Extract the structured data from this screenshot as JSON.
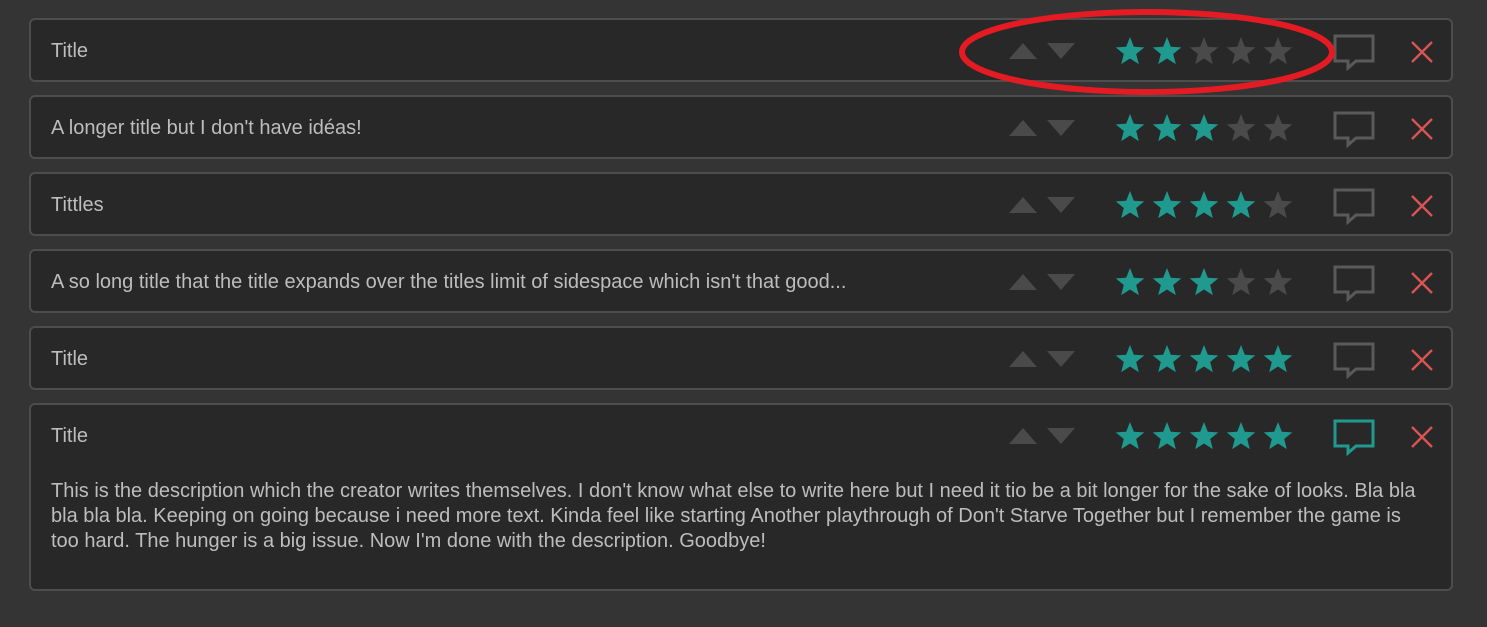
{
  "colors": {
    "background": "#343434",
    "card": "#282828",
    "card_border": "#4d4d4d",
    "text": "#bdbdbd",
    "star_filled": "#20998f",
    "star_empty": "#4a4a4a",
    "arrow": "#4a4a4a",
    "comment_default": "#5a5a5a",
    "comment_active": "#20998f",
    "close": "#d95454",
    "annotation": "#e41b23"
  },
  "items": [
    {
      "title": "Title",
      "rating": 2,
      "max_rating": 5,
      "comment_active": false,
      "expanded": false
    },
    {
      "title": "A longer title but I don't have idéas!",
      "rating": 3,
      "max_rating": 5,
      "comment_active": false,
      "expanded": false
    },
    {
      "title": "Tittles",
      "rating": 4,
      "max_rating": 5,
      "comment_active": false,
      "expanded": false
    },
    {
      "title": "A so long title that the title expands over the titles limit of sidespace which isn't that good...",
      "rating": 3,
      "max_rating": 5,
      "comment_active": false,
      "expanded": false
    },
    {
      "title": "Title",
      "rating": 5,
      "max_rating": 5,
      "comment_active": false,
      "expanded": false
    },
    {
      "title": "Title",
      "rating": 5,
      "max_rating": 5,
      "comment_active": true,
      "expanded": true,
      "description": "This is the description which the creator writes themselves. I don't know what else to write here but I need it tio be a bit longer for the sake of looks. Bla bla bla bla bla. Keeping on going because i need more text. Kinda feel like starting Another playthrough of Don't Starve Together but I remember the game is too hard. The hunger is a big issue. Now I'm done with the description. Goodbye!"
    }
  ],
  "icons": {
    "upvote": "triangle-up-icon",
    "downvote": "triangle-down-icon",
    "star": "star-icon",
    "comment": "speech-bubble-icon",
    "close": "close-x-icon"
  }
}
